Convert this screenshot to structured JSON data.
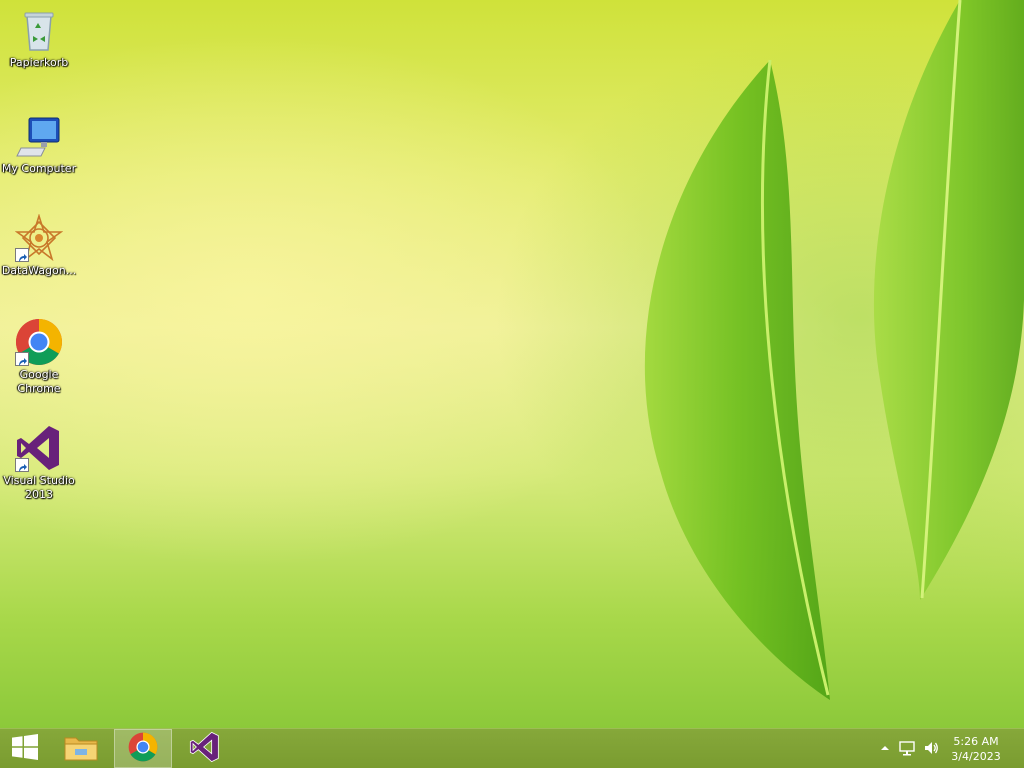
{
  "desktop": {
    "icons": [
      {
        "label": "Papierkorb",
        "icon": "recycle-bin-icon"
      },
      {
        "label": "My Computer",
        "icon": "computer-icon"
      },
      {
        "label": "DataWagon...",
        "icon": "datawagon-icon"
      },
      {
        "label": "Google Chrome",
        "icon": "chrome-icon"
      },
      {
        "label": "Visual Studio 2013",
        "icon": "visual-studio-icon"
      }
    ]
  },
  "taskbar": {
    "start": {
      "icon": "windows-logo-icon"
    },
    "pinned": [
      {
        "icon": "file-explorer-icon",
        "active": false
      },
      {
        "icon": "chrome-icon",
        "active": true
      },
      {
        "icon": "visual-studio-icon",
        "active": false
      }
    ],
    "tray": {
      "icons": [
        "show-hidden-icons-chevron-icon",
        "network-icon",
        "volume-icon"
      ]
    },
    "clock": {
      "time": "5:26 AM",
      "date": "3/4/2023"
    }
  },
  "colors": {
    "taskbar": "#7f9f34",
    "wallpaper_accent": "#a8d84a",
    "visual_studio": "#68217a"
  }
}
